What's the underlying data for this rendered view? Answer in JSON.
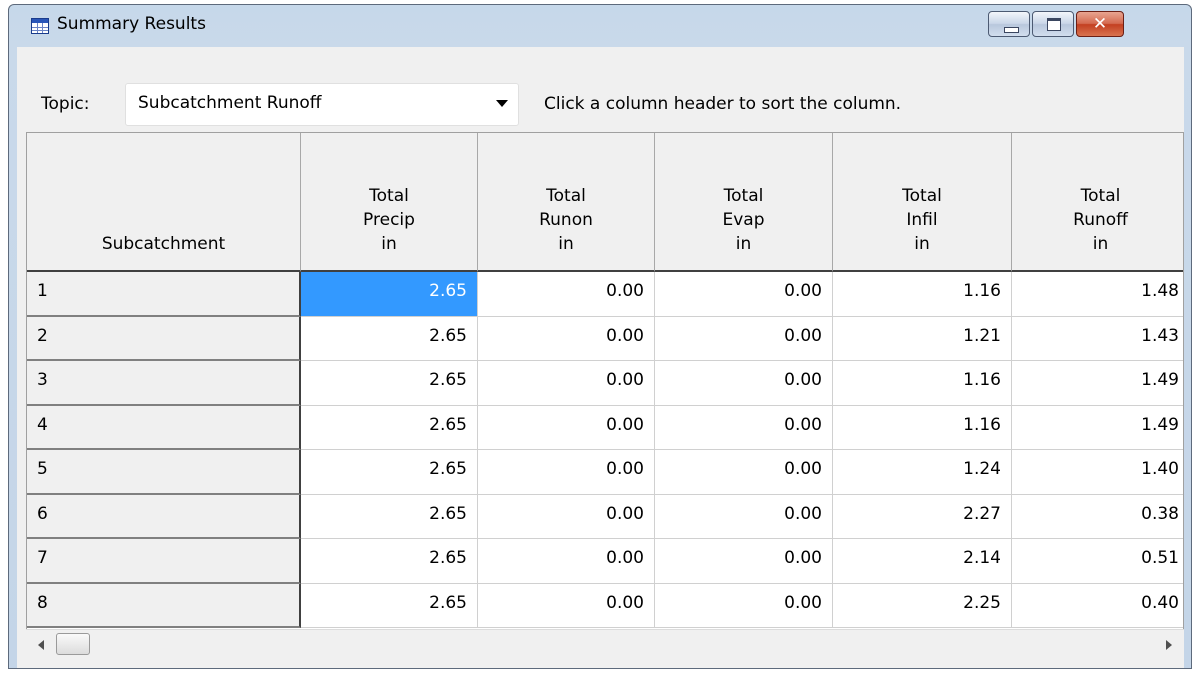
{
  "window": {
    "title": "Summary Results",
    "icon": "table-grid-icon",
    "close_glyph": "✕"
  },
  "topic": {
    "label": "Topic:",
    "value": "Subcatchment Runoff",
    "hint": "Click a column header to sort the column."
  },
  "table": {
    "headers": [
      [
        "Subcatchment"
      ],
      [
        "Total",
        "Precip",
        "in"
      ],
      [
        "Total",
        "Runon",
        "in"
      ],
      [
        "Total",
        "Evap",
        "in"
      ],
      [
        "Total",
        "Infil",
        "in"
      ],
      [
        "Total",
        "Runoff",
        "in"
      ]
    ],
    "rows": [
      [
        "1",
        "2.65",
        "0.00",
        "0.00",
        "1.16",
        "1.48"
      ],
      [
        "2",
        "2.65",
        "0.00",
        "0.00",
        "1.21",
        "1.43"
      ],
      [
        "3",
        "2.65",
        "0.00",
        "0.00",
        "1.16",
        "1.49"
      ],
      [
        "4",
        "2.65",
        "0.00",
        "0.00",
        "1.16",
        "1.49"
      ],
      [
        "5",
        "2.65",
        "0.00",
        "0.00",
        "1.24",
        "1.40"
      ],
      [
        "6",
        "2.65",
        "0.00",
        "0.00",
        "2.27",
        "0.38"
      ],
      [
        "7",
        "2.65",
        "0.00",
        "0.00",
        "2.14",
        "0.51"
      ],
      [
        "8",
        "2.65",
        "0.00",
        "0.00",
        "2.25",
        "0.40"
      ]
    ],
    "selected_cell": {
      "row": 0,
      "col": 1
    }
  },
  "colors": {
    "selection": "#3399ff",
    "titlebar": "#c9d9ea",
    "close_button": "#c33f21"
  }
}
